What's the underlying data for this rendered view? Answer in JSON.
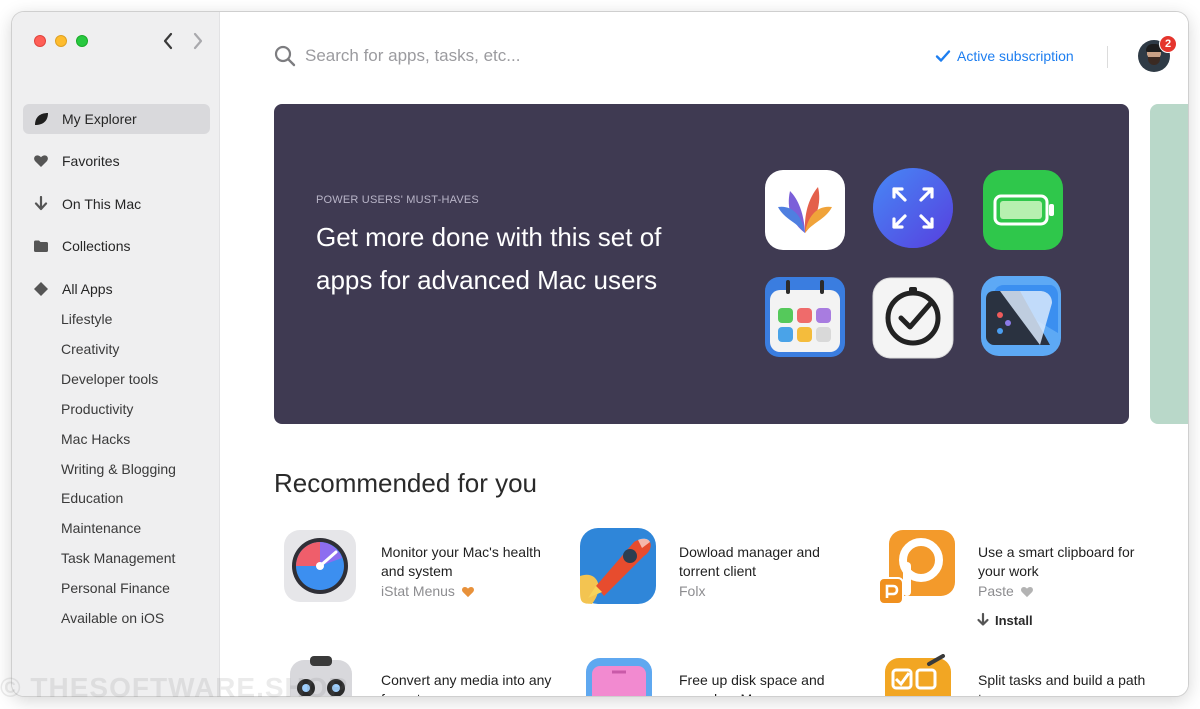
{
  "window": {
    "controls": [
      "close",
      "minimize",
      "zoom"
    ]
  },
  "nav": {
    "back_icon": "chevron-left-icon",
    "forward_icon": "chevron-right-icon"
  },
  "sidebar": {
    "items": [
      {
        "label": "My Explorer",
        "icon": "leaf-icon",
        "active": true
      },
      {
        "label": "Favorites",
        "icon": "heart-icon"
      },
      {
        "label": "On This Mac",
        "icon": "download-arrow-icon"
      },
      {
        "label": "Collections",
        "icon": "folder-icon"
      },
      {
        "label": "All Apps",
        "icon": "diamond-icon"
      }
    ],
    "categories": [
      "Lifestyle",
      "Creativity",
      "Developer tools",
      "Productivity",
      "Mac Hacks",
      "Writing & Blogging",
      "Education",
      "Maintenance",
      "Task Management",
      "Personal Finance",
      "Available on iOS"
    ]
  },
  "header": {
    "search_placeholder": "Search for apps, tasks, etc...",
    "subscription_label": "Active subscription",
    "notifications_count": "2"
  },
  "hero": {
    "eyebrow": "POWER USERS' MUST-HAVES",
    "title": "Get more done with this set of apps for advanced Mac users",
    "icons": [
      "mindnode-leaf-icon",
      "expand-arrows-icon",
      "battery-icon",
      "calendar-grid-icon",
      "checkmark-clock-icon",
      "ui-layers-icon"
    ]
  },
  "recommended": {
    "title": "Recommended for you",
    "items": [
      {
        "description": "Monitor your Mac's health and system",
        "name": "iStat Menus",
        "favorite_color": "#e8913a",
        "icon": "gauge-icon"
      },
      {
        "description": "Dowload manager and torrent client",
        "name": "Folx",
        "icon": "rocket-icon"
      },
      {
        "description": "Use a smart clipboard for your work",
        "name": "Paste",
        "favorite_color": "#b3b3b3",
        "icon": "paste-icon",
        "action": "Install"
      },
      {
        "description": "Convert any media into any format",
        "icon": "robot-icon"
      },
      {
        "description": "Free up disk space and speed up Mac",
        "icon": "disk-cleaner-icon"
      },
      {
        "description": "Split tasks and build a path to success",
        "icon": "checklist-icon"
      }
    ]
  },
  "colors": {
    "accent": "#1d7ef0",
    "hero_bg": "#3f3a52",
    "sidebar_bg": "#efeff0",
    "badge": "#e5352d"
  },
  "watermark": "© THESOFTWARE.SHOP"
}
